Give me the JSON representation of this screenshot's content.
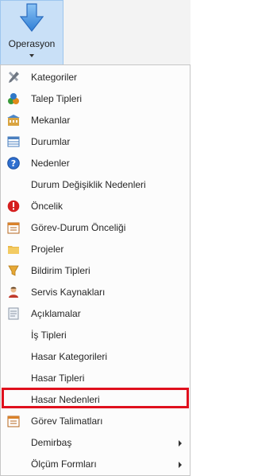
{
  "ribbon": {
    "button_label": "Operasyon",
    "icon": "down-arrow-icon"
  },
  "menu": {
    "items": [
      {
        "label": "Kategoriler",
        "icon": "tools-icon"
      },
      {
        "label": "Talep Tipleri",
        "icon": "colored-shapes-icon"
      },
      {
        "label": "Mekanlar",
        "icon": "building-icon"
      },
      {
        "label": "Durumlar",
        "icon": "list-table-icon"
      },
      {
        "label": "Nedenler",
        "icon": "help-icon"
      },
      {
        "label": "Durum Değişiklik Nedenleri",
        "icon": ""
      },
      {
        "label": "Öncelik",
        "icon": "alert-icon"
      },
      {
        "label": "Görev-Durum Önceliği",
        "icon": "calendar-icon"
      },
      {
        "label": "Projeler",
        "icon": "folder-icon"
      },
      {
        "label": "Bildirim Tipleri",
        "icon": "notification-icon"
      },
      {
        "label": "Servis Kaynakları",
        "icon": "user-icon"
      },
      {
        "label": "Açıklamalar",
        "icon": "notes-icon"
      },
      {
        "label": "İş Tipleri",
        "icon": ""
      },
      {
        "label": "Hasar Kategorileri",
        "icon": ""
      },
      {
        "label": "Hasar Tipleri",
        "icon": ""
      },
      {
        "label": "Hasar Nedenleri",
        "icon": "",
        "highlighted": true
      },
      {
        "label": "Görev Talimatları",
        "icon": "calendar-icon"
      },
      {
        "label": "Demirbaş",
        "icon": "",
        "submenu": true
      },
      {
        "label": "Ölçüm Formları",
        "icon": "",
        "submenu": true
      }
    ]
  },
  "colors": {
    "highlight_border": "#e0101d",
    "ribbon_button_bg": "#c9e0f7"
  }
}
